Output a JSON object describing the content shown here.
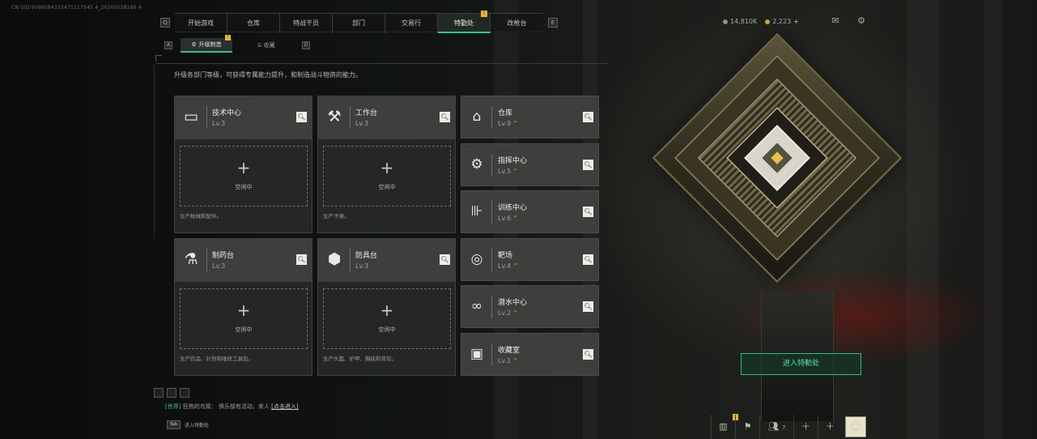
{
  "uid": "CN UID:9099584333471117545 4_20260528180 4",
  "top_nav": {
    "prev_key": "Q",
    "next_key": "E",
    "tabs": [
      {
        "label": "开始游戏"
      },
      {
        "label": "仓库"
      },
      {
        "label": "特战干员"
      },
      {
        "label": "部门"
      },
      {
        "label": "交易行"
      },
      {
        "label": "特勤处",
        "active": true,
        "badge": "!"
      },
      {
        "label": "改枪台"
      }
    ]
  },
  "resources": {
    "currency_a": "14,810K",
    "currency_b": "2,223",
    "plus": "+"
  },
  "sub_nav": {
    "prev_key": "A",
    "next_key": "D",
    "tabs": [
      {
        "label": "升级制造",
        "active": true,
        "badge": "!"
      },
      {
        "label": "收藏"
      }
    ]
  },
  "description": "升级各部门等级，可获得专属能力提升，和制造战斗物资的能力。",
  "production_cards": [
    {
      "name": "技术中心",
      "level": "Lv.3",
      "icon": "computer-icon",
      "slot_label": "空闲中",
      "slot_plus": "+",
      "produces": "生产枪械和配件。"
    },
    {
      "name": "工作台",
      "level": "Lv.3",
      "icon": "tools-icon",
      "slot_label": "空闲中",
      "slot_plus": "+",
      "produces": "生产子弹。"
    },
    {
      "name": "制药台",
      "level": "Lv.3",
      "icon": "microscope-icon",
      "slot_label": "空闲中",
      "slot_plus": "+",
      "produces": "生产药品、针剂和维修工具包。"
    },
    {
      "name": "防具台",
      "level": "Lv.3",
      "icon": "armor-blocks-icon",
      "slot_label": "空闲中",
      "slot_plus": "+",
      "produces": "生产头盔、护甲、胸挂和背包。"
    }
  ],
  "facilities": [
    {
      "name": "仓库",
      "level": "Lv.9",
      "icon": "warehouse-icon",
      "upgradable": true
    },
    {
      "name": "指挥中心",
      "level": "Lv.5",
      "icon": "chip-icon",
      "upgradable": true
    },
    {
      "name": "训练中心",
      "level": "Lv.6",
      "icon": "dumbbell-icon",
      "upgradable": true
    },
    {
      "name": "靶场",
      "level": "Lv.4",
      "icon": "target-icon",
      "upgradable": true
    },
    {
      "name": "潜水中心",
      "level": "Lv.2",
      "icon": "diving-goggles-icon",
      "upgradable": true
    },
    {
      "name": "收藏室",
      "level": "Lv.1",
      "icon": "collection-icon",
      "upgradable": true
    }
  ],
  "enter_button": "进入特勤处",
  "chat": {
    "channel": "[世界]",
    "sender": "狂热的鸟窝",
    "message": "俱乐部有活动，来人",
    "link": "[点击进入]"
  },
  "tab_hint": {
    "key": "Tab",
    "label": "进入特勤处"
  },
  "bottom_bar": {
    "social_count": "7",
    "badge": "!"
  },
  "colors": {
    "accent": "#33c586",
    "badge": "#e4b53b",
    "upgrade_arrow": "#d9a93b"
  }
}
